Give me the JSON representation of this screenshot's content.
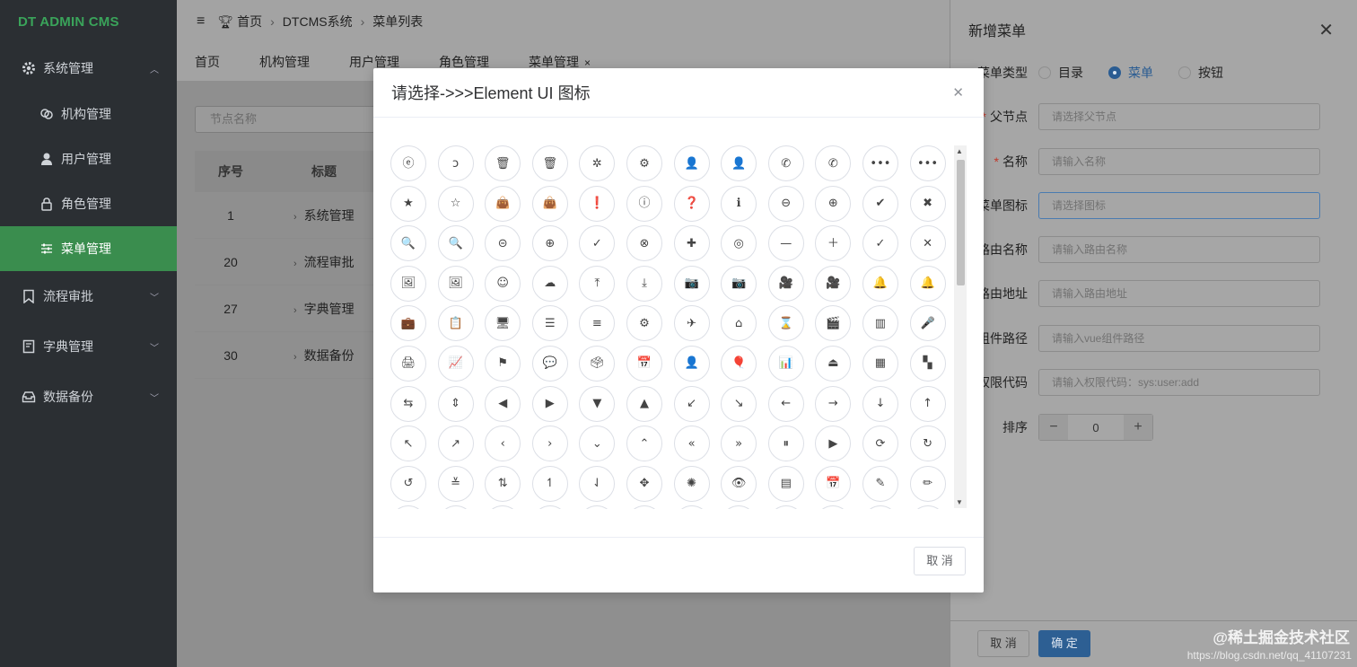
{
  "brand": "DT ADMIN CMS",
  "sidebar": {
    "groups": [
      {
        "label": "系统管理",
        "icon": "gear-icon"
      },
      {
        "label": "流程审批",
        "icon": "bookmark-icon"
      },
      {
        "label": "字典管理",
        "icon": "book-icon"
      },
      {
        "label": "数据备份",
        "icon": "database-icon"
      }
    ],
    "items": [
      {
        "label": "机构管理",
        "icon": "org-icon"
      },
      {
        "label": "用户管理",
        "icon": "user-icon"
      },
      {
        "label": "角色管理",
        "icon": "lock-icon"
      },
      {
        "label": "菜单管理",
        "icon": "sliders-icon"
      }
    ]
  },
  "topbar": {
    "breadcrumb": [
      "首页",
      "DTCMS系统",
      "菜单列表"
    ]
  },
  "tabs": [
    "首页",
    "机构管理",
    "用户管理",
    "角色管理",
    "菜单管理"
  ],
  "search": {
    "placeholder": "节点名称"
  },
  "table": {
    "headers": [
      "序号",
      "标题"
    ],
    "rows": [
      {
        "no": "1",
        "title": "系统管理"
      },
      {
        "no": "20",
        "title": "流程审批"
      },
      {
        "no": "27",
        "title": "字典管理"
      },
      {
        "no": "30",
        "title": "数据备份"
      }
    ]
  },
  "drawer": {
    "title": "新增菜单",
    "type_label": "菜单类型",
    "type_options": [
      "目录",
      "菜单",
      "按钮"
    ],
    "selected_type": "菜单",
    "parent_label": "父节点",
    "parent_placeholder": "请选择父节点",
    "name_label": "名称",
    "name_placeholder": "请输入名称",
    "icon_label": "菜单图标",
    "icon_placeholder": "请选择图标",
    "route_name_label": "路由名称",
    "route_name_placeholder": "请输入路由名称",
    "route_path_label": "路由地址",
    "route_path_placeholder": "请输入路由地址",
    "component_label": "组件路径",
    "component_placeholder": "请输入vue组件路径",
    "perm_label": "权限代码",
    "perm_placeholder": "请输入权限代码：sys:user:add",
    "sort_label": "排序",
    "sort_value": "0",
    "cancel": "取 消",
    "confirm": "确 定"
  },
  "dialog": {
    "title": "请选择->>>Element UI 图标",
    "cancel": "取 消",
    "icons": [
      "ⓔ",
      "ↄ",
      "🗑",
      "🗑",
      "✲",
      "⚙",
      "👤",
      "👤",
      "✆",
      "✆",
      "•••",
      "•••",
      "★",
      "☆",
      "👜",
      "👜",
      "❗",
      "ⓘ",
      "❓",
      "ℹ",
      "⊖",
      "⊕",
      "✔",
      "✖",
      "🔍",
      "🔍",
      "⊝",
      "⊕",
      "✓",
      "⊗",
      "✚",
      "◎",
      "—",
      "＋",
      "✓",
      "✕",
      "🖼",
      "🖼",
      "☺",
      "☁",
      "⤒",
      "⤓",
      "📷",
      "📷",
      "🎥",
      "🎥",
      "🔔",
      "🔔",
      "💼",
      "📋",
      "🖥",
      "☰",
      "≡",
      "⚙",
      "✈",
      "⌂",
      "⌛",
      "🎬",
      "▥",
      "🎤",
      "🖨",
      "📈",
      "⚑",
      "💬",
      "🗳",
      "📅",
      "👤",
      "🎈",
      "📊",
      "⏏",
      "▦",
      "▚",
      "⇆",
      "⇕",
      "◀",
      "▶",
      "▼",
      "▲",
      "↙",
      "↘",
      "←",
      "→",
      "↓",
      "↑",
      "↖",
      "↗",
      "‹",
      "›",
      "⌄",
      "⌃",
      "«",
      "»",
      "⏸",
      "▶",
      "⟳",
      "↻",
      "↺",
      "≚",
      "⇅",
      "↿",
      "⇃",
      "✥",
      "✺",
      "👁",
      "▤",
      "📅",
      "✎",
      "✏",
      "○",
      "○",
      "○",
      "○",
      "○",
      "○",
      "○",
      "○",
      "○",
      "○",
      "○",
      "○"
    ]
  },
  "watermark": "@稀土掘金技术社区",
  "url": "https://blog.csdn.net/qq_41107231"
}
